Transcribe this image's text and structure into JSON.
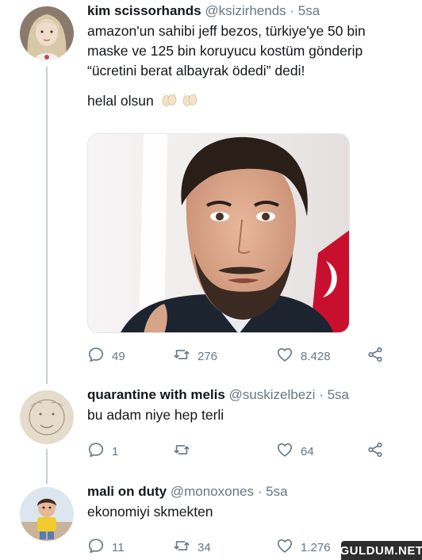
{
  "tweets": [
    {
      "name": "kim scissorhands",
      "handle": "@ksizirhends",
      "separator": "·",
      "time": "5sa",
      "text_lines": [
        "amazon'un sahibi jeff bezos, türkiye'ye 50 bin",
        "maske ve 125 bin koruyucu kostüm gönderip",
        "“ücretini berat albayrak ödedi” dedi!"
      ],
      "text_extra": "helal olsun",
      "extra_emoji": "clap-hands-icon",
      "actions": {
        "reply": "49",
        "retweet": "276",
        "like": "8.428"
      }
    },
    {
      "name": "quarantine with melis",
      "handle": "@suskizelbezi",
      "separator": "·",
      "time": "5sa",
      "text": "bu adam niye hep terli",
      "actions": {
        "reply": "1",
        "retweet": "",
        "like": "64"
      }
    },
    {
      "name": "mali on duty",
      "handle": "@monoxones",
      "separator": "·",
      "time": "5sa",
      "text": "ekonomiyi skmekten",
      "actions": {
        "reply": "11",
        "retweet": "34",
        "like": "1.276"
      }
    }
  ],
  "watermark": "GULDUM.NET",
  "colors": {
    "text": "#14171a",
    "muted": "#657786",
    "thread": "#c4cfd6"
  }
}
